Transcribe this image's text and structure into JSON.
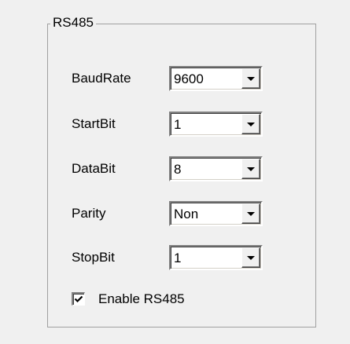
{
  "group": {
    "title": "RS485"
  },
  "fields": [
    {
      "label": "BaudRate",
      "value": "9600"
    },
    {
      "label": "StartBit",
      "value": "1"
    },
    {
      "label": "DataBit",
      "value": "8"
    },
    {
      "label": "Parity",
      "value": "Non"
    },
    {
      "label": "StopBit",
      "value": "1"
    }
  ],
  "enable": {
    "label": "Enable RS485",
    "checked": true
  },
  "icons": {
    "dropdown": "chevron-down-icon",
    "check": "checkmark-icon"
  }
}
